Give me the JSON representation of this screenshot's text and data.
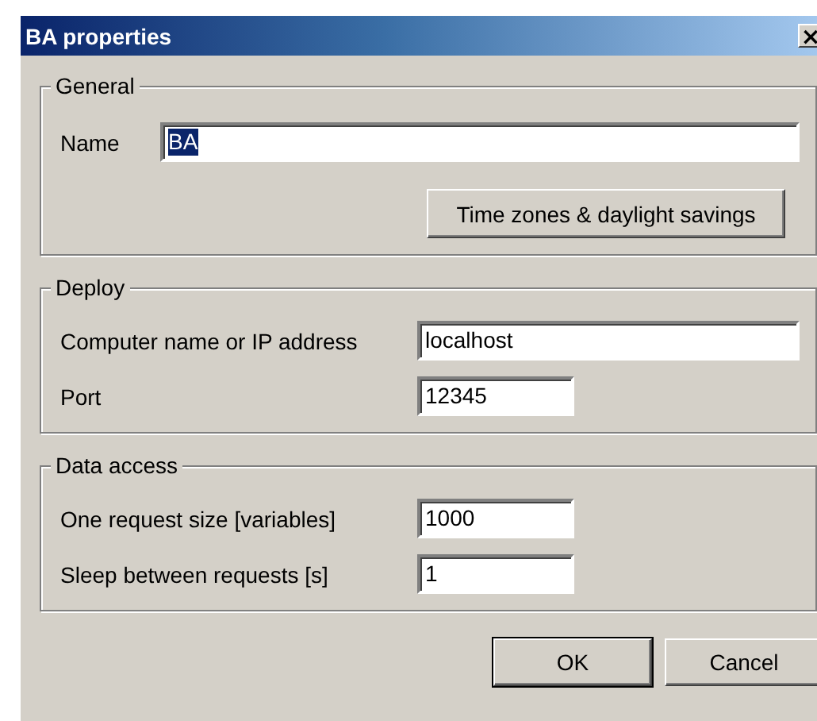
{
  "window": {
    "title": "BA properties",
    "close": "×"
  },
  "groups": [
    {
      "title": "General",
      "rows": [
        {
          "label": "Name",
          "value": "BA",
          "text_selected": true
        }
      ],
      "button": "Time zones & daylight savings"
    },
    {
      "title": "Deploy",
      "rows": [
        {
          "label": "Computer name or IP address",
          "value": "localhost",
          "text_selected": false
        },
        {
          "label": "Port",
          "value": "12345",
          "text_selected": false
        }
      ]
    },
    {
      "title": "Data access",
      "rows": [
        {
          "label": "One request size [variables]",
          "value": "1000",
          "text_selected": false
        },
        {
          "label": "Sleep between requests [s]",
          "value": "1",
          "text_selected": false
        }
      ]
    }
  ],
  "buttons": [
    {
      "label": "OK",
      "default": true
    },
    {
      "label": "Cancel",
      "default": false
    }
  ]
}
